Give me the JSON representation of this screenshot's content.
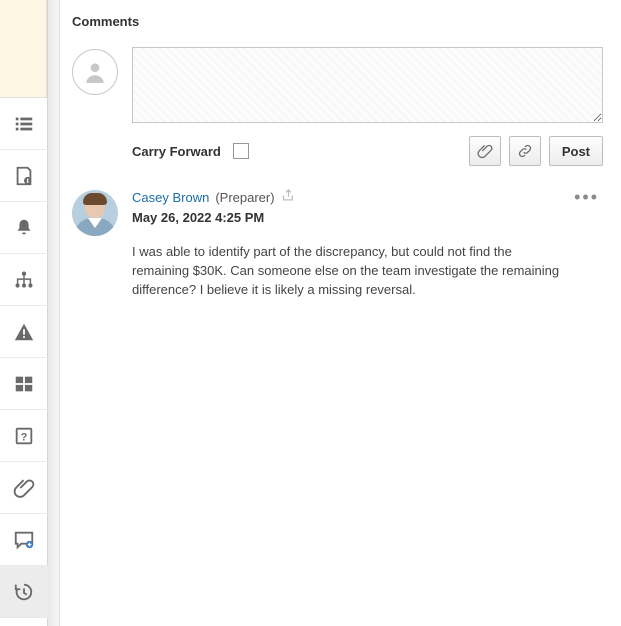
{
  "section_title": "Comments",
  "composer": {
    "value": "",
    "placeholder": "",
    "carry_forward_label": "Carry Forward",
    "post_label": "Post"
  },
  "sidebar": {
    "items": [
      {
        "name": "worklist"
      },
      {
        "name": "details"
      },
      {
        "name": "alerts-bell"
      },
      {
        "name": "hierarchy"
      },
      {
        "name": "warnings"
      },
      {
        "name": "layout"
      },
      {
        "name": "help"
      },
      {
        "name": "attachments"
      },
      {
        "name": "comments"
      },
      {
        "name": "history"
      }
    ]
  },
  "comments": [
    {
      "author": "Casey Brown",
      "role": "(Preparer)",
      "date": "May 26, 2022 4:25 PM",
      "text": "I was able to identify part of the discrepancy, but could not find the remaining $30K. Can someone else on the team investigate the remaining difference? I believe it is likely a missing reversal."
    }
  ]
}
